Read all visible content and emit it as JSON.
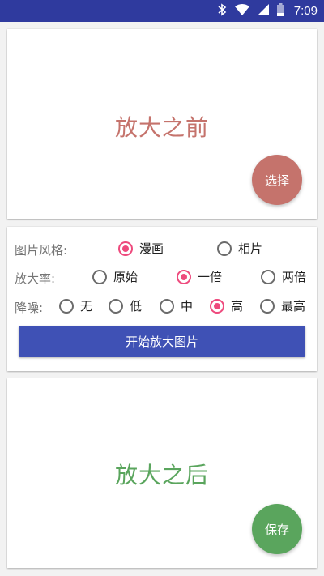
{
  "status_bar": {
    "time": "7:09",
    "icons": [
      "bluetooth-icon",
      "wifi-icon",
      "signal-icon",
      "battery-icon"
    ],
    "bg_color": "#2f3a9e"
  },
  "before_card": {
    "placeholder": "放大之前",
    "placeholder_color": "#c5736c",
    "fab_label": "选择",
    "fab_color": "#c5736c"
  },
  "options": {
    "style": {
      "label": "图片风格:",
      "choices": [
        "漫画",
        "相片"
      ],
      "selected": "漫画"
    },
    "scale": {
      "label": "放大率:",
      "choices": [
        "原始",
        "一倍",
        "两倍"
      ],
      "selected": "一倍"
    },
    "noise": {
      "label": "降噪:",
      "choices": [
        "无",
        "低",
        "中",
        "高",
        "最高"
      ],
      "selected": "高"
    },
    "accent_color": "#ee4a7d",
    "start_button_label": "开始放大图片",
    "start_button_color": "#3f51b5"
  },
  "after_card": {
    "placeholder": "放大之后",
    "placeholder_color": "#5aa55d",
    "fab_label": "保存",
    "fab_color": "#5aa55d"
  }
}
